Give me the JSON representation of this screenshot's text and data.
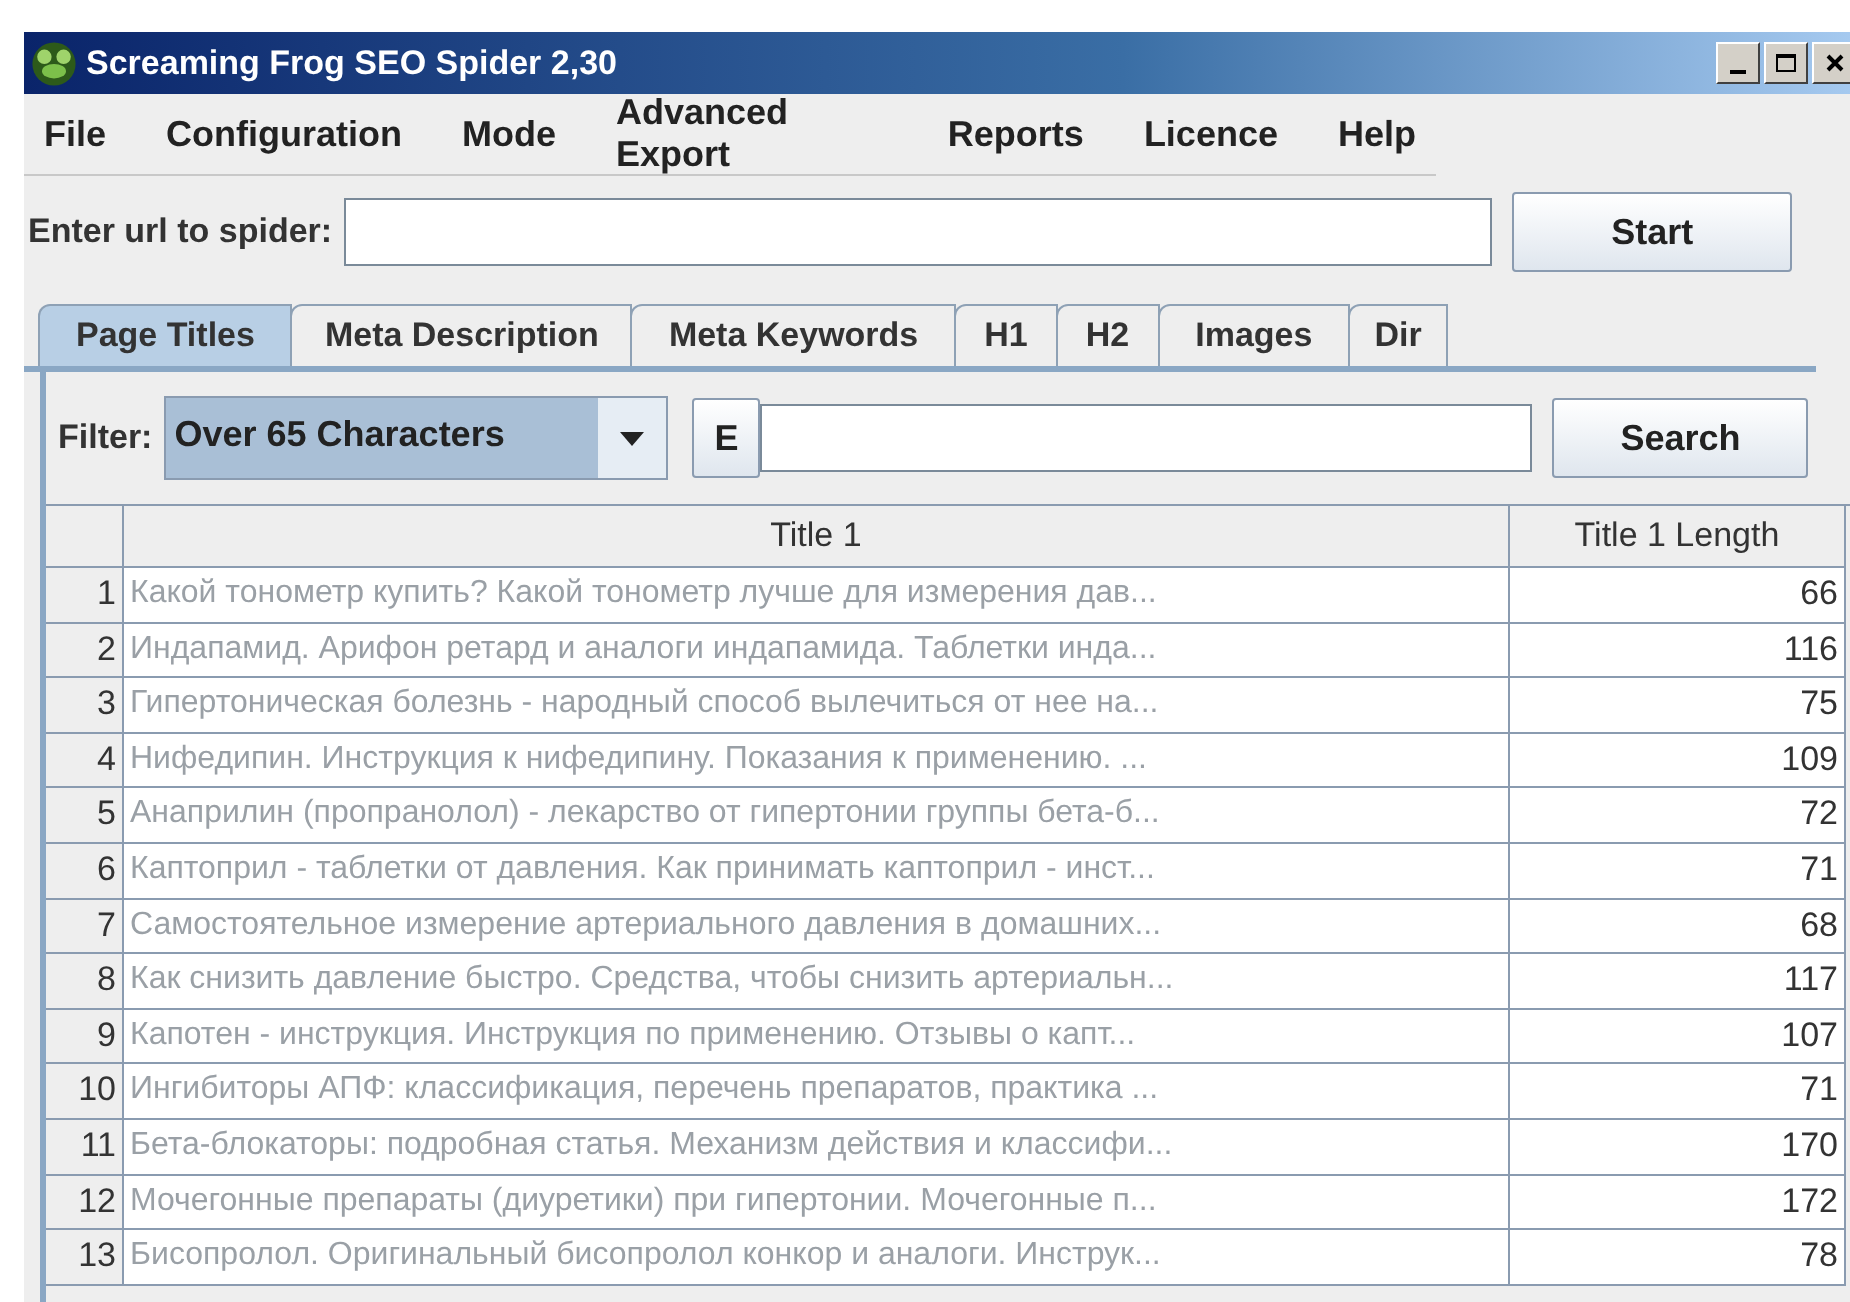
{
  "window": {
    "title": "Screaming Frog SEO Spider 2,30"
  },
  "menu": [
    "File",
    "Configuration",
    "Mode",
    "Advanced Export",
    "Reports",
    "Licence",
    "Help"
  ],
  "url_bar": {
    "label": "Enter url to spider:",
    "button": "Start"
  },
  "tabs": [
    {
      "label": "Page Titles",
      "selected": true
    },
    {
      "label": "Meta Description",
      "selected": false
    },
    {
      "label": "Meta Keywords",
      "selected": false
    },
    {
      "label": "H1",
      "selected": false
    },
    {
      "label": "H2",
      "selected": false
    },
    {
      "label": "Images",
      "selected": false
    },
    {
      "label": "Dir",
      "selected": false
    }
  ],
  "filter": {
    "label": "Filter:",
    "value": "Over 65 Characters",
    "export_button": "E",
    "search_button": "Search"
  },
  "table": {
    "columns": [
      "Title 1",
      "Title 1 Length"
    ],
    "rows": [
      {
        "index": "1",
        "title": "Какой тонометр купить? Какой тонометр лучше для измерения дав...",
        "length": "66"
      },
      {
        "index": "2",
        "title": "Индапамид. Арифон ретард и аналоги индапамида. Таблетки инда...",
        "length": "116"
      },
      {
        "index": "3",
        "title": "Гипертоническая болезнь - народный способ вылечиться от нее на...",
        "length": "75"
      },
      {
        "index": "4",
        "title": "Нифедипин. Инструкция к нифедипину. Показания к применению. ...",
        "length": "109"
      },
      {
        "index": "5",
        "title": "Анаприлин (пропранолол) - лекарство от гипертонии группы бета-б...",
        "length": "72"
      },
      {
        "index": "6",
        "title": "Каптоприл - таблетки от давления. Как принимать каптоприл - инст...",
        "length": "71"
      },
      {
        "index": "7",
        "title": "Самостоятельное измерение артериального давления в домашних...",
        "length": "68"
      },
      {
        "index": "8",
        "title": "Как снизить давление быстро. Средства, чтобы снизить артериальн...",
        "length": "117"
      },
      {
        "index": "9",
        "title": "Капотен - инструкция. Инструкция по применению. Отзывы о капт...",
        "length": "107"
      },
      {
        "index": "10",
        "title": "Ингибиторы АПФ: классификация, перечень препаратов, практика ...",
        "length": "71"
      },
      {
        "index": "11",
        "title": "Бета-блокаторы: подробная статья. Механизм действия и классифи...",
        "length": "170"
      },
      {
        "index": "12",
        "title": "Мочегонные препараты (диуретики) при гипертонии. Мочегонные п...",
        "length": "172"
      },
      {
        "index": "13",
        "title": "Бисопролол. Оригинальный бисопролол конкор и аналоги. Инструк...",
        "length": "78"
      }
    ]
  }
}
